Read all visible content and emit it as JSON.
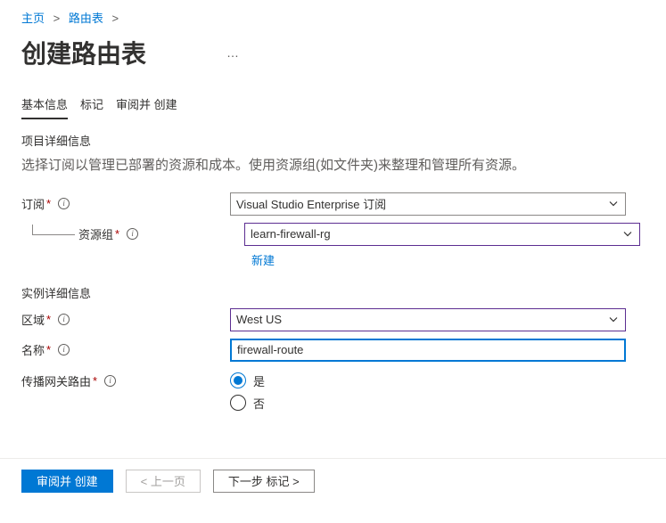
{
  "breadcrumb": {
    "home": "主页",
    "current": "路由表"
  },
  "page_title": "创建路由表",
  "tabs": {
    "basic": "基本信息",
    "tags": "标记",
    "review": "审阅并 创建"
  },
  "project_details": {
    "heading": "项目详细信息",
    "description": "选择订阅以管理已部署的资源和成本。使用资源组(如文件夹)来整理和管理所有资源。",
    "subscription_label": "订阅",
    "subscription_value": "Visual Studio Enterprise 订阅",
    "resource_group_label": "资源组",
    "resource_group_value": "learn-firewall-rg",
    "new_link": "新建"
  },
  "instance_details": {
    "heading": "实例详细信息",
    "region_label": "区域",
    "region_value": "West US",
    "name_label": "名称",
    "name_value": "firewall-route",
    "propagate_label": "传播网关路由",
    "yes": "是",
    "no": "否"
  },
  "footer": {
    "review_create": "审阅并 创建",
    "previous": "< 上一页",
    "next": "下一步 标记 >"
  }
}
